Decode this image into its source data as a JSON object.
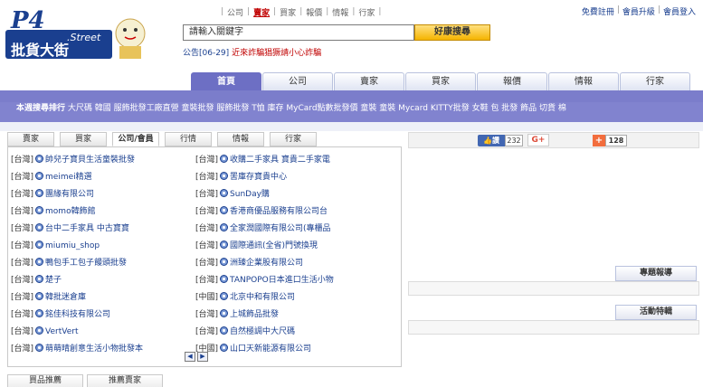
{
  "logo": {
    "main": "P4",
    "sub": ".Street",
    "title": "批貨大街"
  },
  "topnav": {
    "items": [
      {
        "label": "公司",
        "active": false
      },
      {
        "label": "賣家",
        "active": true
      },
      {
        "label": "買家",
        "active": false
      },
      {
        "label": "報價",
        "active": false
      },
      {
        "label": "情報",
        "active": false
      },
      {
        "label": "行家",
        "active": false
      }
    ]
  },
  "rightlinks": [
    "免費註冊",
    "會員升級",
    "會員登入"
  ],
  "search": {
    "value": "請輸入關鍵字",
    "button": "好康搜尋"
  },
  "notice": {
    "prefix": "公告[06-29]",
    "message": "近來詐騙猖獗請小心詐騙"
  },
  "maintabs": [
    {
      "label": "首頁",
      "active": true
    },
    {
      "label": "公司",
      "active": false
    },
    {
      "label": "賣家",
      "active": false
    },
    {
      "label": "買家",
      "active": false
    },
    {
      "label": "報價",
      "active": false
    },
    {
      "label": "情報",
      "active": false
    },
    {
      "label": "行家",
      "active": false
    }
  ],
  "hot": {
    "title": "本週搜尋排行",
    "items": "大尺碼 韓國 服飾批發工廠直營 童裝批發 服飾批發 T恤 庫存 MyCard點數批發價 童裝 童裝 Mycard KITTY批發 女鞋 包 批發 飾品 切貨 棉"
  },
  "subtabs": [
    {
      "label": "賣家",
      "active": false
    },
    {
      "label": "買家",
      "active": false
    },
    {
      "label": "公司/會員",
      "active": true
    },
    {
      "label": "行情",
      "active": false
    },
    {
      "label": "情報",
      "active": false
    },
    {
      "label": "行家",
      "active": false
    }
  ],
  "list_left": [
    {
      "region": "[台灣]",
      "name": "帥兒子寶貝生活童裝批發"
    },
    {
      "region": "[台灣]",
      "name": "meimei精選"
    },
    {
      "region": "[台灣]",
      "name": "團緣有限公司"
    },
    {
      "region": "[台灣]",
      "name": "momo韓飾館"
    },
    {
      "region": "[台灣]",
      "name": "台中二手家具 中古寶寶"
    },
    {
      "region": "[台灣]",
      "name": "miumiu_shop"
    },
    {
      "region": "[台灣]",
      "name": "鴨包手工包子饅頭批發"
    },
    {
      "region": "[台灣]",
      "name": "楚子"
    },
    {
      "region": "[台灣]",
      "name": "韓批迷倉庫"
    },
    {
      "region": "[台灣]",
      "name": "銘佳科技有限公司"
    },
    {
      "region": "[台灣]",
      "name": "VertVert"
    },
    {
      "region": "[台灣]",
      "name": "萌萌晴創意生活小物批發本"
    }
  ],
  "list_right": [
    {
      "region": "[台灣]",
      "name": "收購二手家具 寶貴二手家電"
    },
    {
      "region": "[台灣]",
      "name": "罟庫存寶貴中心"
    },
    {
      "region": "[台灣]",
      "name": "SunDay購"
    },
    {
      "region": "[台灣]",
      "name": "香港商優品服務有限公司台"
    },
    {
      "region": "[台灣]",
      "name": "全家潤國際有限公司(專櫃品"
    },
    {
      "region": "[台灣]",
      "name": "國際通訊(全省)門號換現"
    },
    {
      "region": "[台灣]",
      "name": "洲臻企業股有限公司"
    },
    {
      "region": "[台灣]",
      "name": "TANPOPO日本進口生活小物"
    },
    {
      "region": "[中國]",
      "name": "北京中和有限公司"
    },
    {
      "region": "[台灣]",
      "name": "上城飾品批發"
    },
    {
      "region": "[台灣]",
      "name": "自然極調中大尺碼"
    },
    {
      "region": "[中國]",
      "name": "山口天新能源有限公司"
    }
  ],
  "pager": {
    "prev": "◀",
    "next": "▶"
  },
  "social": {
    "like_label": "讚",
    "like_count": "232",
    "gplus": "G+",
    "plus_count": "128"
  },
  "right_sections": [
    "專題報導",
    "活動特輯"
  ],
  "bottabs": [
    "買品推薦",
    "推薦賣家"
  ]
}
